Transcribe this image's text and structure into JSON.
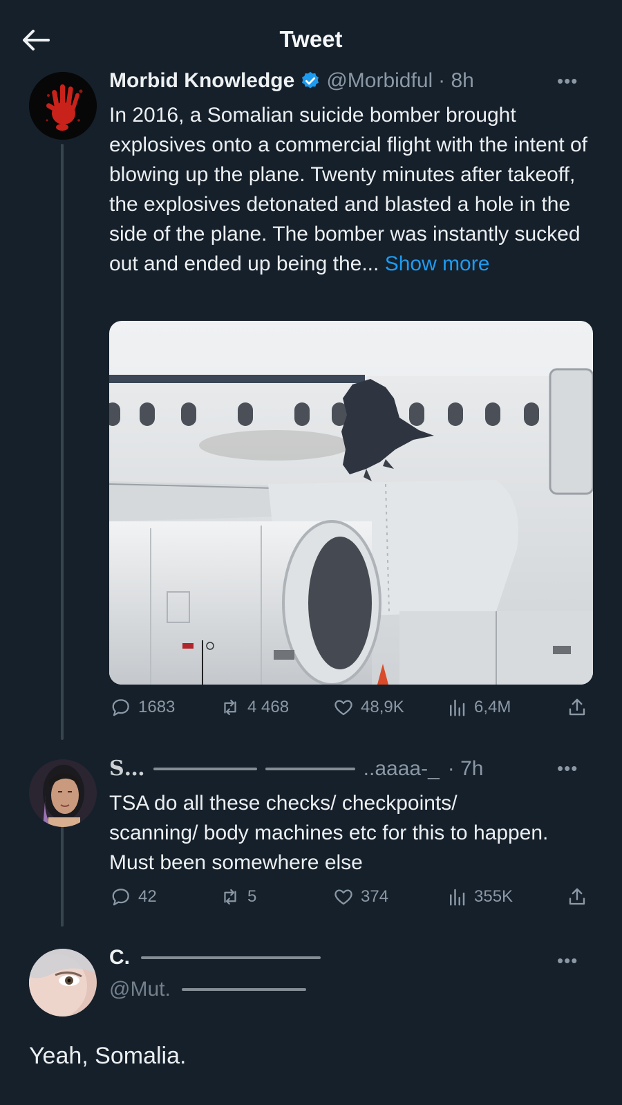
{
  "header": {
    "title": "Tweet",
    "back_icon": "arrow-left-icon"
  },
  "main_tweet": {
    "author": "Morbid Knowledge",
    "verified": true,
    "handle": "@Morbidful",
    "time": "· 8h",
    "text": "In 2016, a Somalian suicide bomber brought explosives onto a commercial flight with the intent of blowing up the plane. Twenty minutes after takeoff, the explosives detonated and blasted a hole in the side of the plane. The bomber was instantly sucked out and ended up being the...",
    "show_more": "Show more",
    "stats": {
      "replies": "1683",
      "retweets": "4 468",
      "likes": "48,9K",
      "views": "6,4M"
    }
  },
  "reply_1": {
    "author_obscured": "Ѕ…",
    "handle_obscured": "..aaaa-_",
    "time": "· 7h",
    "text": "TSA do all these checks/ checkpoints/ scanning/ body machines etc for this to happen. Must been somewhere else",
    "stats": {
      "replies": "42",
      "retweets": "5",
      "likes": "374",
      "views": "355K"
    }
  },
  "reply_2": {
    "author_obscured": "C.",
    "handle_obscured": "@Mut.",
    "text": "Yeah, Somalia."
  },
  "colors": {
    "background": "#15202b",
    "accent": "#1d9bf0",
    "muted": "#8b98a5"
  }
}
